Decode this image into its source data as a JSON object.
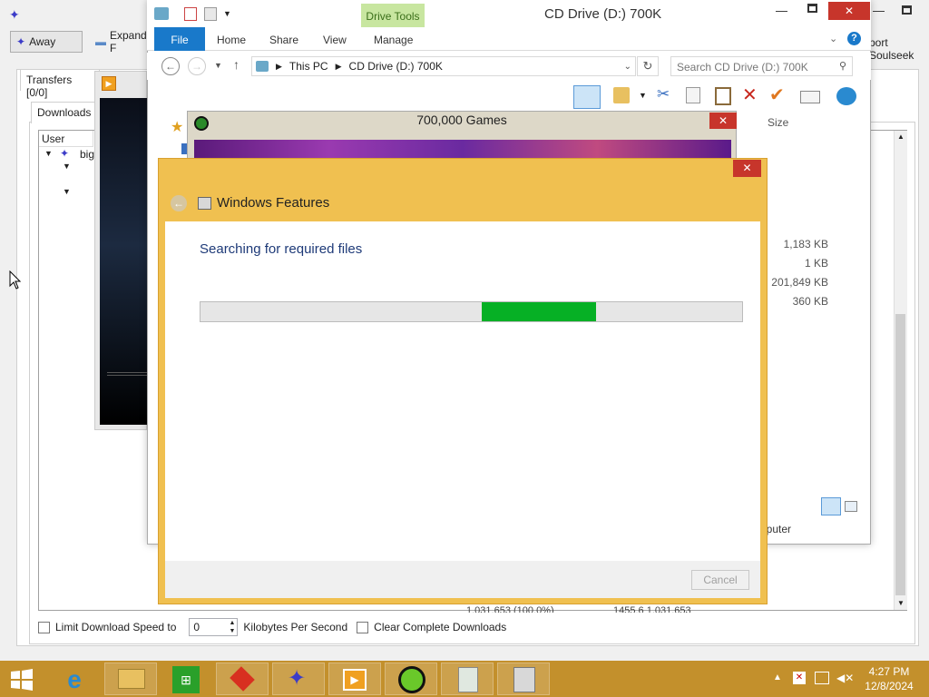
{
  "soulseek": {
    "away_label": "Away",
    "expand_label": "Expand F",
    "support_label": "port Soulseek",
    "transfers_tab": "Transfers [0/0]",
    "downloads_tab": "Downloads",
    "user_col": "User",
    "user_row": "big",
    "limit_label": "Limit Download Speed to",
    "limit_value": "0",
    "kbps_label": "Kilobytes Per Second",
    "clear_label": "Clear Complete Downloads",
    "bg_row_fragment": "1,031,653 (100.0%)",
    "bg_row_fragment2": "1455.6 1,031,653"
  },
  "explorer": {
    "title": "CD Drive (D:) 700K",
    "drive_tools": "Drive Tools",
    "tabs": [
      "File",
      "Home",
      "Share",
      "View",
      "Manage"
    ],
    "breadcrumb": [
      "This PC",
      "CD Drive (D:) 700K"
    ],
    "search_placeholder": "Search CD Drive (D:) 700K",
    "size_header": "Size",
    "sizes": [
      "1,183 KB",
      "1 KB",
      "201,849 KB",
      "360 KB"
    ],
    "computer_label": "nputer"
  },
  "games": {
    "title": "700,000 Games"
  },
  "features": {
    "title": "Windows Features",
    "message": "Searching for required files",
    "cancel_label": "Cancel",
    "progress_start_fraction": 0.52,
    "progress_end_fraction": 0.73
  },
  "taskbar": {
    "time": "4:27 PM",
    "date": "12/8/2024",
    "apps": [
      "start",
      "internet-explorer",
      "file-explorer",
      "store",
      "red-app",
      "soulseek",
      "media-player",
      "games",
      "recycle",
      "disk"
    ]
  },
  "colors": {
    "taskbar": "#c3902c",
    "dialog_frame": "#f0c050",
    "progress": "#06b025",
    "file_tab": "#1979ca",
    "close": "#c7352b"
  }
}
